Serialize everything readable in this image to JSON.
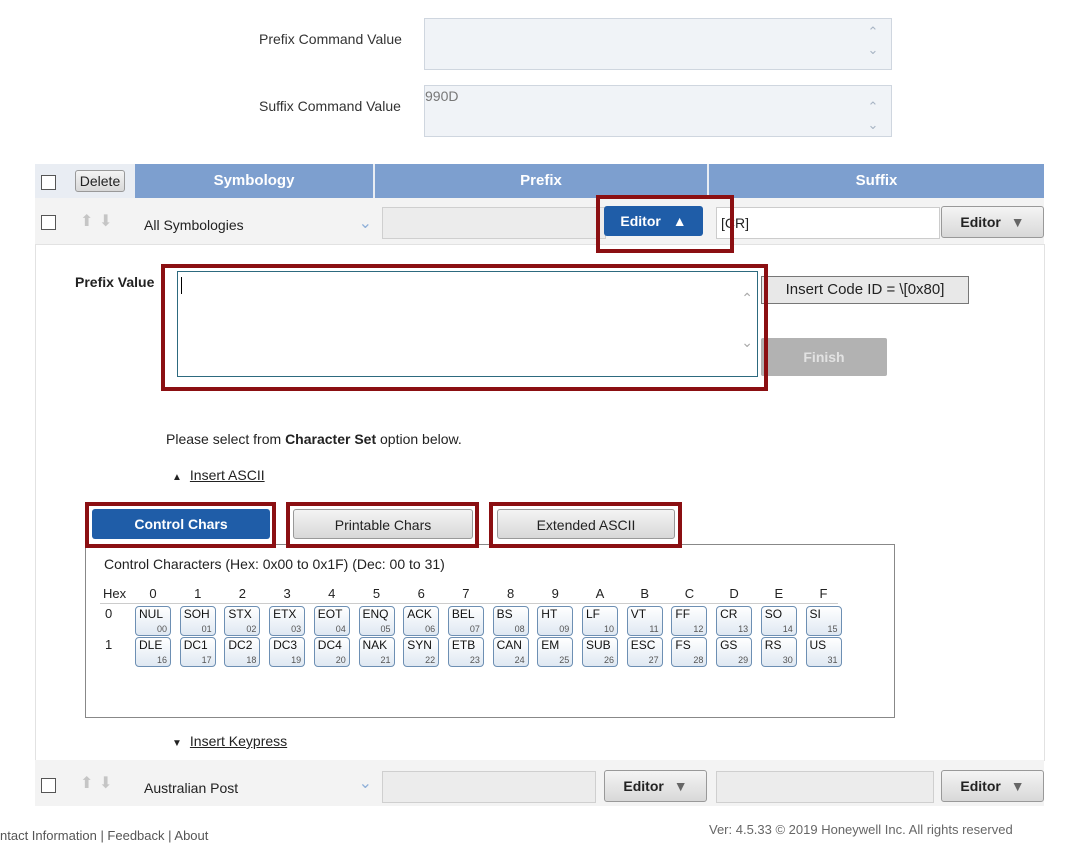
{
  "command_values": {
    "prefix_label": "Prefix Command Value",
    "prefix_value": "",
    "suffix_label": "Suffix Command Value",
    "suffix_value": "990D"
  },
  "table": {
    "delete_label": "Delete",
    "col_symbology": "Symbology",
    "col_prefix": "Prefix",
    "col_suffix": "Suffix",
    "rows": [
      {
        "symbology": "All Symbologies",
        "prefix": "",
        "suffix": "[CR]",
        "prefix_editor": "Editor",
        "suffix_editor": "Editor"
      },
      {
        "symbology": "Australian Post",
        "prefix": "",
        "suffix": "",
        "prefix_editor": "Editor",
        "suffix_editor": "Editor"
      }
    ]
  },
  "editor": {
    "prefix_value_label": "Prefix Value",
    "insert_code_id": "Insert Code ID = \\[0x80]",
    "finish": "Finish",
    "instruction_pre": "Please select from ",
    "instruction_bold": "Character Set",
    "instruction_post": " option below.",
    "insert_ascii": "Insert ASCII",
    "insert_keypress": "Insert Keypress",
    "tabs": [
      "Control Chars",
      "Printable Chars",
      "Extended ASCII"
    ],
    "panel_title": "Control Characters (Hex: 0x00 to 0x1F) (Dec: 00 to 31)",
    "hex_label": "Hex",
    "hex_columns": [
      "0",
      "1",
      "2",
      "3",
      "4",
      "5",
      "6",
      "7",
      "8",
      "9",
      "A",
      "B",
      "C",
      "D",
      "E",
      "F"
    ],
    "rows": [
      {
        "row": "0",
        "chars": [
          {
            "n": "NUL",
            "d": "00"
          },
          {
            "n": "SOH",
            "d": "01"
          },
          {
            "n": "STX",
            "d": "02"
          },
          {
            "n": "ETX",
            "d": "03"
          },
          {
            "n": "EOT",
            "d": "04"
          },
          {
            "n": "ENQ",
            "d": "05"
          },
          {
            "n": "ACK",
            "d": "06"
          },
          {
            "n": "BEL",
            "d": "07"
          },
          {
            "n": "BS",
            "d": "08"
          },
          {
            "n": "HT",
            "d": "09"
          },
          {
            "n": "LF",
            "d": "10"
          },
          {
            "n": "VT",
            "d": "11"
          },
          {
            "n": "FF",
            "d": "12"
          },
          {
            "n": "CR",
            "d": "13"
          },
          {
            "n": "SO",
            "d": "14"
          },
          {
            "n": "SI",
            "d": "15"
          }
        ]
      },
      {
        "row": "1",
        "chars": [
          {
            "n": "DLE",
            "d": "16"
          },
          {
            "n": "DC1",
            "d": "17"
          },
          {
            "n": "DC2",
            "d": "18"
          },
          {
            "n": "DC3",
            "d": "19"
          },
          {
            "n": "DC4",
            "d": "20"
          },
          {
            "n": "NAK",
            "d": "21"
          },
          {
            "n": "SYN",
            "d": "22"
          },
          {
            "n": "ETB",
            "d": "23"
          },
          {
            "n": "CAN",
            "d": "24"
          },
          {
            "n": "EM",
            "d": "25"
          },
          {
            "n": "SUB",
            "d": "26"
          },
          {
            "n": "ESC",
            "d": "27"
          },
          {
            "n": "FS",
            "d": "28"
          },
          {
            "n": "GS",
            "d": "29"
          },
          {
            "n": "RS",
            "d": "30"
          },
          {
            "n": "US",
            "d": "31"
          }
        ]
      }
    ]
  },
  "footer": {
    "links": "ntact Information | Feedback | About",
    "version": "Ver: 4.5.33 © 2019 Honeywell Inc. All rights reserved"
  },
  "colors": {
    "accent": "#1f5da8",
    "header": "#7d9fcf",
    "highlight": "#8b0f12"
  },
  "icons": [
    "chevron-up-icon",
    "chevron-down-icon",
    "arrow-up-icon",
    "arrow-down-icon",
    "triangle-up-icon",
    "triangle-down-icon"
  ]
}
